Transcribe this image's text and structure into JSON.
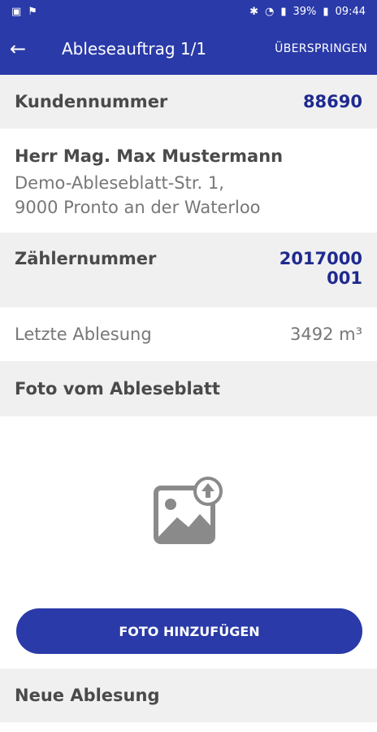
{
  "status_bar": {
    "battery": "39%",
    "time": "09:44"
  },
  "app_bar": {
    "title": "Ableseauftrag 1/1",
    "action": "ÜBERSPRINGEN"
  },
  "customer_number": {
    "label": "Kundennummer",
    "value": "88690"
  },
  "customer": {
    "name": "Herr Mag. Max Mustermann",
    "address_line1": "Demo-Ableseblatt-Str. 1,",
    "address_line2": "9000 Pronto an der Waterloo"
  },
  "meter_number": {
    "label": "Zählernummer",
    "value_line1": "2017000",
    "value_line2": "001"
  },
  "last_reading": {
    "label": "Letzte Ablesung",
    "value": "3492 m³"
  },
  "photo_section": {
    "label": "Foto vom Ableseblatt",
    "button_label": "FOTO HINZUFÜGEN"
  },
  "new_reading": {
    "label": "Neue Ablesung"
  }
}
